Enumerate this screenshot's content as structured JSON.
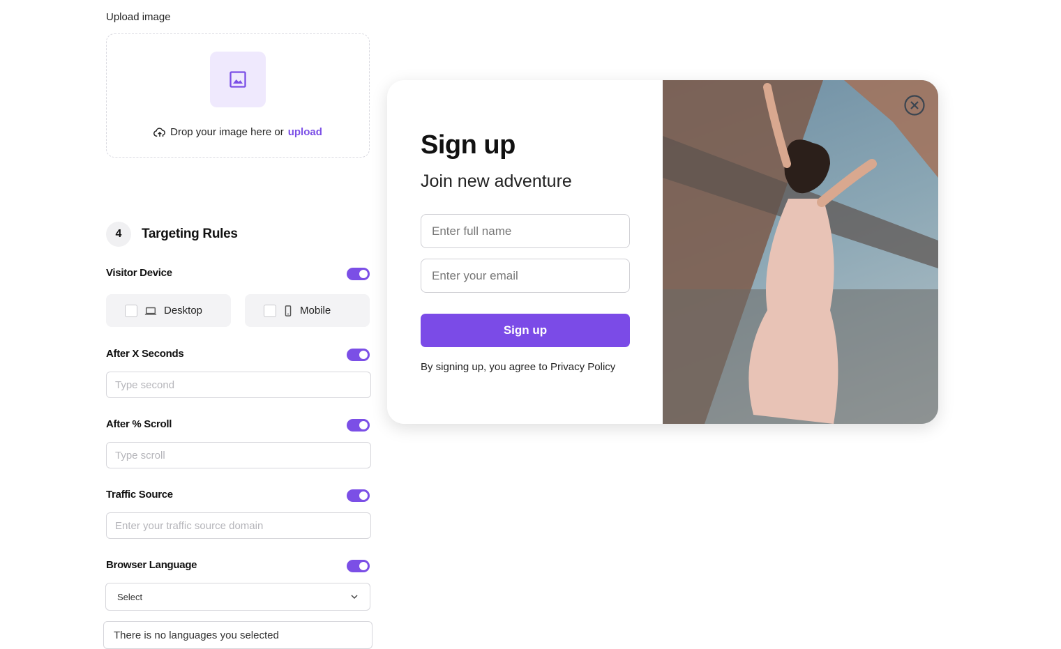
{
  "upload": {
    "label": "Upload image",
    "drop_text": "Drop your image here or",
    "link_text": "upload"
  },
  "targeting": {
    "step_number": "4",
    "title": "Targeting Rules",
    "visitor_device": {
      "label": "Visitor Device",
      "enabled": true,
      "options": [
        {
          "label": "Desktop",
          "checked": false,
          "icon": "laptop-icon"
        },
        {
          "label": "Mobile",
          "checked": false,
          "icon": "mobile-icon"
        }
      ]
    },
    "after_seconds": {
      "label": "After X Seconds",
      "enabled": true,
      "placeholder": "Type second"
    },
    "after_scroll": {
      "label": "After % Scroll",
      "enabled": true,
      "placeholder": "Type scroll"
    },
    "traffic_source": {
      "label": "Traffic Source",
      "enabled": true,
      "placeholder": "Enter your traffic source domain"
    },
    "browser_language": {
      "label": "Browser Language",
      "enabled": true,
      "select_value": "Select",
      "empty_text": "There is no languages you selected"
    }
  },
  "popup": {
    "title": "Sign up",
    "subtitle": "Join new adventure",
    "name_placeholder": "Enter full name",
    "email_placeholder": "Enter your email",
    "button_label": "Sign up",
    "disclaimer": "By signing up, you agree to Privacy Policy"
  },
  "colors": {
    "accent": "#7b4fe6",
    "accent_light": "#efe9fd"
  }
}
